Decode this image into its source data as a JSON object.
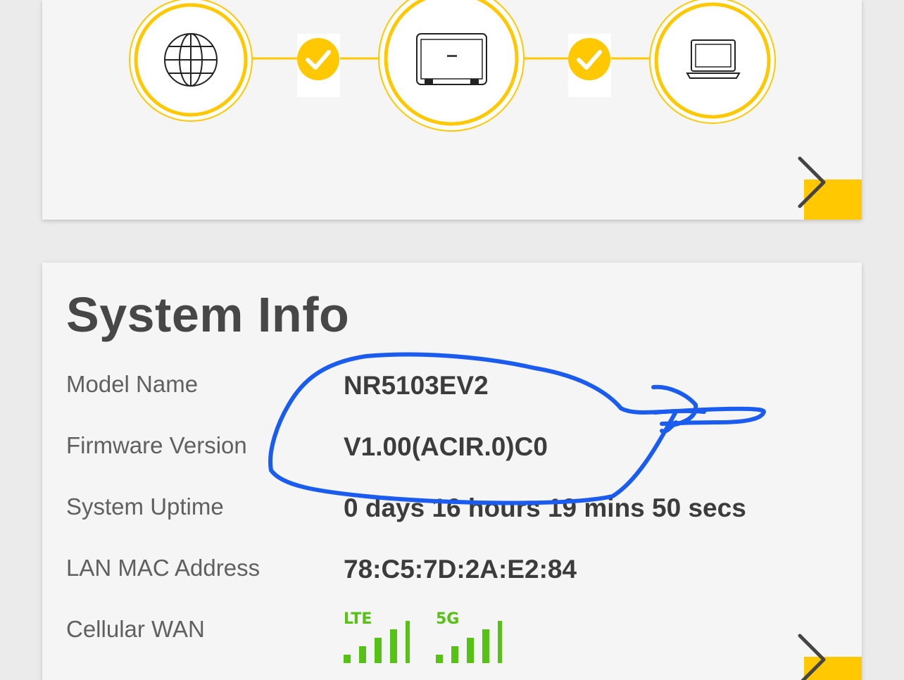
{
  "topology": {
    "nodes": [
      {
        "name": "internet",
        "icon": "globe-icon"
      },
      {
        "name": "router",
        "icon": "router-icon"
      },
      {
        "name": "device",
        "icon": "laptop-icon"
      }
    ],
    "links": [
      {
        "status": "connected",
        "icon": "check-icon"
      },
      {
        "status": "connected",
        "icon": "check-icon"
      }
    ],
    "accent_color": "#ffc800"
  },
  "system_info": {
    "title": "System Info",
    "rows": [
      {
        "label": "Model Name",
        "value": "NR5103EV2"
      },
      {
        "label": "Firmware Version",
        "value": "V1.00(ACIR.0)C0"
      },
      {
        "label": "System Uptime",
        "value": "0 days 16 hours 19 mins 50 secs"
      },
      {
        "label": "LAN MAC Address",
        "value": "78:C5:7D:2A:E2:84"
      },
      {
        "label": "Cellular WAN",
        "value": ""
      }
    ],
    "cellular_signals": [
      {
        "label": "LTE",
        "bars": 5,
        "max_bars": 5
      },
      {
        "label": "5G",
        "bars": 5,
        "max_bars": 5
      }
    ],
    "signal_color": "#55c214"
  },
  "annotation": {
    "color": "#1a5cf0",
    "shape": "hand-drawn-circle-arrow"
  }
}
